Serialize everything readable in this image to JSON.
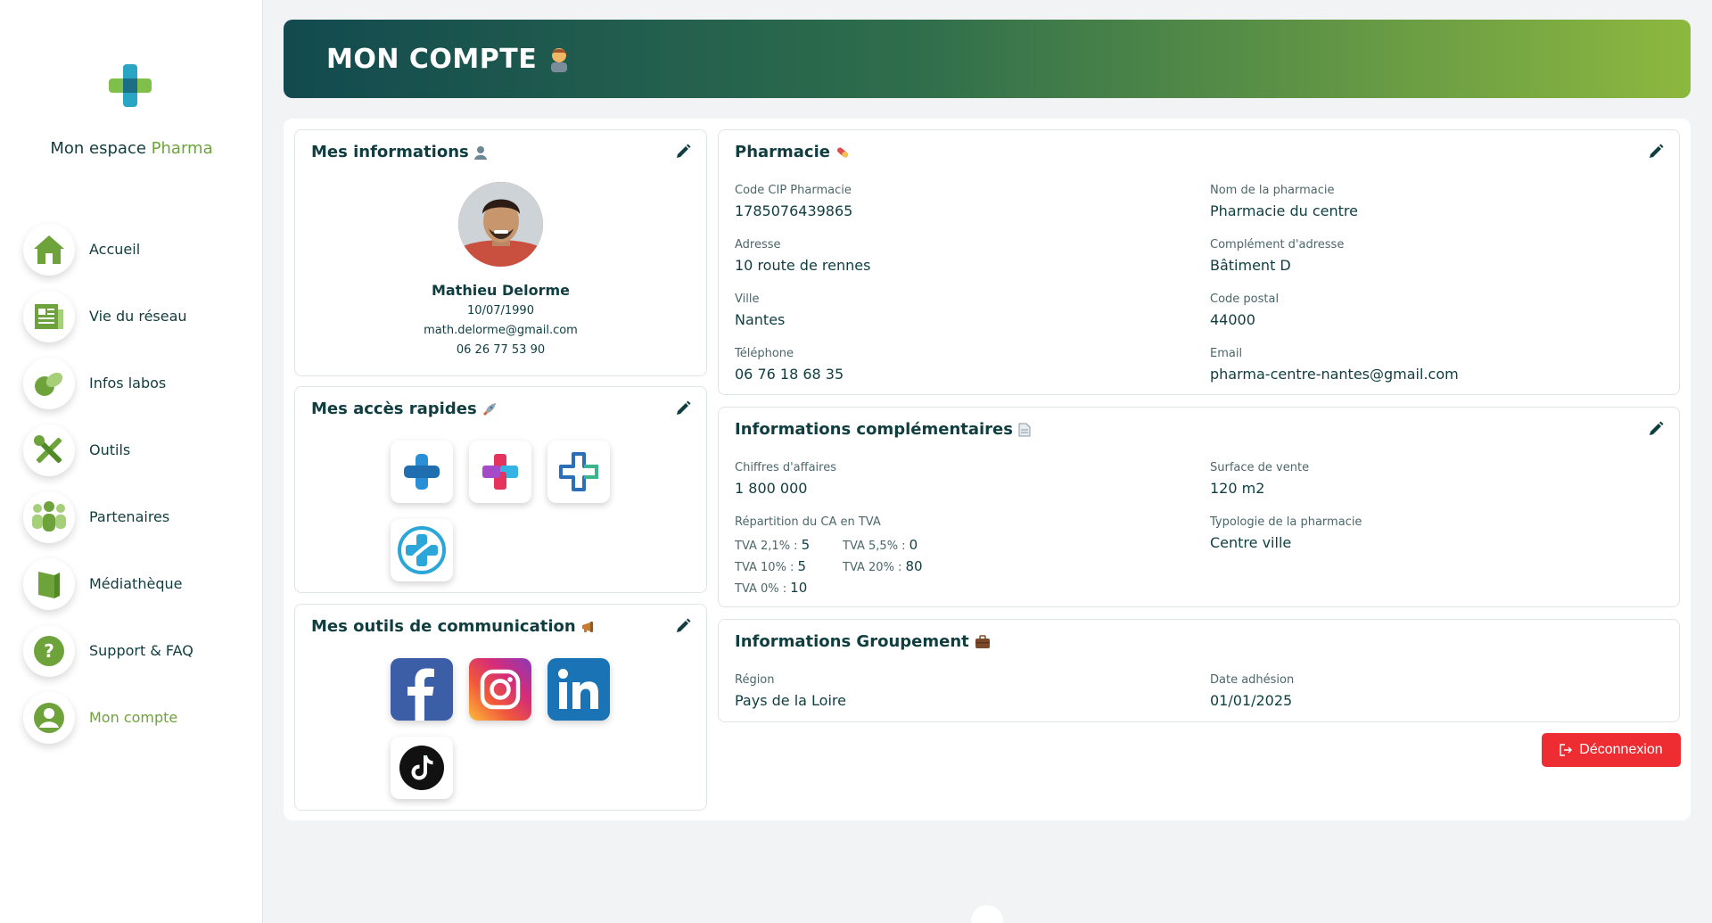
{
  "sidebar": {
    "brand_prefix": "Mon espace",
    "brand_accent": "Pharma",
    "items": [
      {
        "label": "Accueil",
        "icon": "home-icon"
      },
      {
        "label": "Vie du réseau",
        "icon": "newspaper-icon"
      },
      {
        "label": "Infos labos",
        "icon": "pills-icon"
      },
      {
        "label": "Outils",
        "icon": "tools-icon"
      },
      {
        "label": "Partenaires",
        "icon": "partners-icon"
      },
      {
        "label": "Médiathèque",
        "icon": "book-icon"
      },
      {
        "label": "Support & FAQ",
        "icon": "question-icon"
      },
      {
        "label": "Mon compte",
        "icon": "user-icon",
        "active": true
      }
    ]
  },
  "header": {
    "title": "MON COMPTE",
    "emoji": "🙋"
  },
  "infos": {
    "title": "Mes informations",
    "name": "Mathieu Delorme",
    "birthdate": "10/07/1990",
    "email": "math.delorme@gmail.com",
    "phone": "06 26 77 53 90"
  },
  "quick_access": {
    "title": "Mes accès rapides"
  },
  "communication": {
    "title": "Mes outils de communication"
  },
  "pharmacy": {
    "title": "Pharmacie",
    "fields": {
      "cip_label": "Code CIP Pharmacie",
      "cip_value": "1785076439865",
      "name_label": "Nom de la pharmacie",
      "name_value": "Pharmacie du centre",
      "address_label": "Adresse",
      "address_value": "10 route de rennes",
      "complement_label": "Complément d'adresse",
      "complement_value": "Bâtiment D",
      "city_label": "Ville",
      "city_value": "Nantes",
      "postal_label": "Code postal",
      "postal_value": "44000",
      "phone_label": "Téléphone",
      "phone_value": "06 76 18 68 35",
      "email_label": "Email",
      "email_value": "pharma-centre-nantes@gmail.com"
    }
  },
  "complementary": {
    "title": "Informations complémentaires",
    "ca_label": "Chiffres d'affaires",
    "ca_value": "1 800 000",
    "surface_label": "Surface de vente",
    "surface_value": "120 m2",
    "repartition_label": "Répartition du CA en TVA",
    "tva": {
      "t21_label": "TVA 2,1% :",
      "t21_value": "5",
      "t55_label": "TVA 5,5% :",
      "t55_value": "0",
      "t10_label": "TVA 10% :",
      "t10_value": "5",
      "t20_label": "TVA 20% :",
      "t20_value": "80",
      "t0_label": "TVA 0% :",
      "t0_value": "10"
    },
    "typology_label": "Typologie de la pharmacie",
    "typology_value": "Centre ville"
  },
  "groupement": {
    "title": "Informations Groupement",
    "region_label": "Région",
    "region_value": "Pays de la Loire",
    "date_label": "Date adhésion",
    "date_value": "01/01/2025"
  },
  "logout_label": "Déconnexion",
  "colors": {
    "accent_green": "#6ea33c",
    "dark_teal": "#0f3d40",
    "danger": "#ee2d32"
  }
}
